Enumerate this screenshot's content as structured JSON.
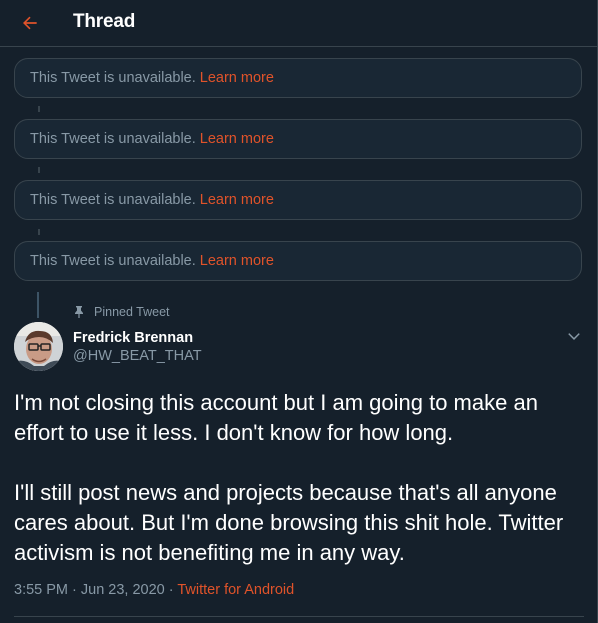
{
  "header": {
    "title": "Thread"
  },
  "unavailable_tweets": [
    {
      "text": "This Tweet is unavailable.",
      "link": "Learn more"
    },
    {
      "text": "This Tweet is unavailable.",
      "link": "Learn more"
    },
    {
      "text": "This Tweet is unavailable.",
      "link": "Learn more"
    },
    {
      "text": "This Tweet is unavailable.",
      "link": "Learn more"
    }
  ],
  "tweet": {
    "pinned_label": "Pinned Tweet",
    "author_name": "Fredrick Brennan",
    "author_handle": "@HW_BEAT_THAT",
    "paragraph_1": "I'm not closing this account but I am going to make an effort to use it less. I don't know for how long.",
    "paragraph_2": "I'll still post news and projects because that's all anyone cares about. But I'm done browsing this shit hole. Twitter activism is not benefiting me in any way.",
    "timestamp": "3:55 PM · Jun 23, 2020 · ",
    "source": "Twitter for Android"
  },
  "icons": {
    "back": "arrow-left-icon",
    "pin": "pin-icon",
    "more": "chevron-down-icon"
  },
  "colors": {
    "background": "#15202b",
    "accent": "#e0532a",
    "secondary_text": "#8899a6",
    "border": "#38444d"
  }
}
